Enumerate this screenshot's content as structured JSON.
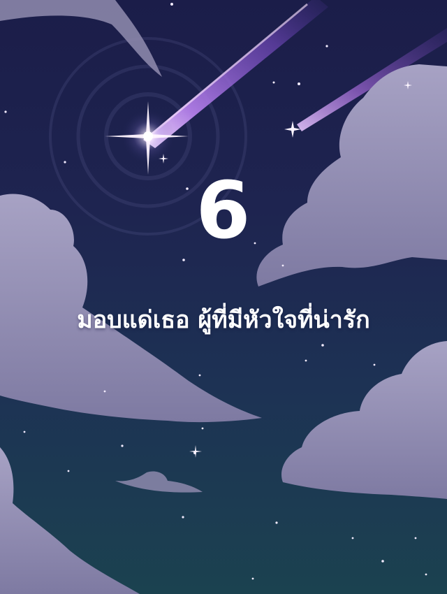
{
  "poster": {
    "number": "6",
    "caption": "มอบแด่เธอ ผู้ที่มีหัวใจที่น่ารัก"
  },
  "colors": {
    "sky_top": "#1b1d49",
    "sky_bottom": "#1b4250",
    "cloud": "#8e89ad",
    "meteor": "#9b6ad8",
    "text": "#ffffff"
  },
  "decorations": {
    "icons": [
      "shooting-star-icon",
      "sparkle-star-icon",
      "cloud-icon"
    ]
  }
}
